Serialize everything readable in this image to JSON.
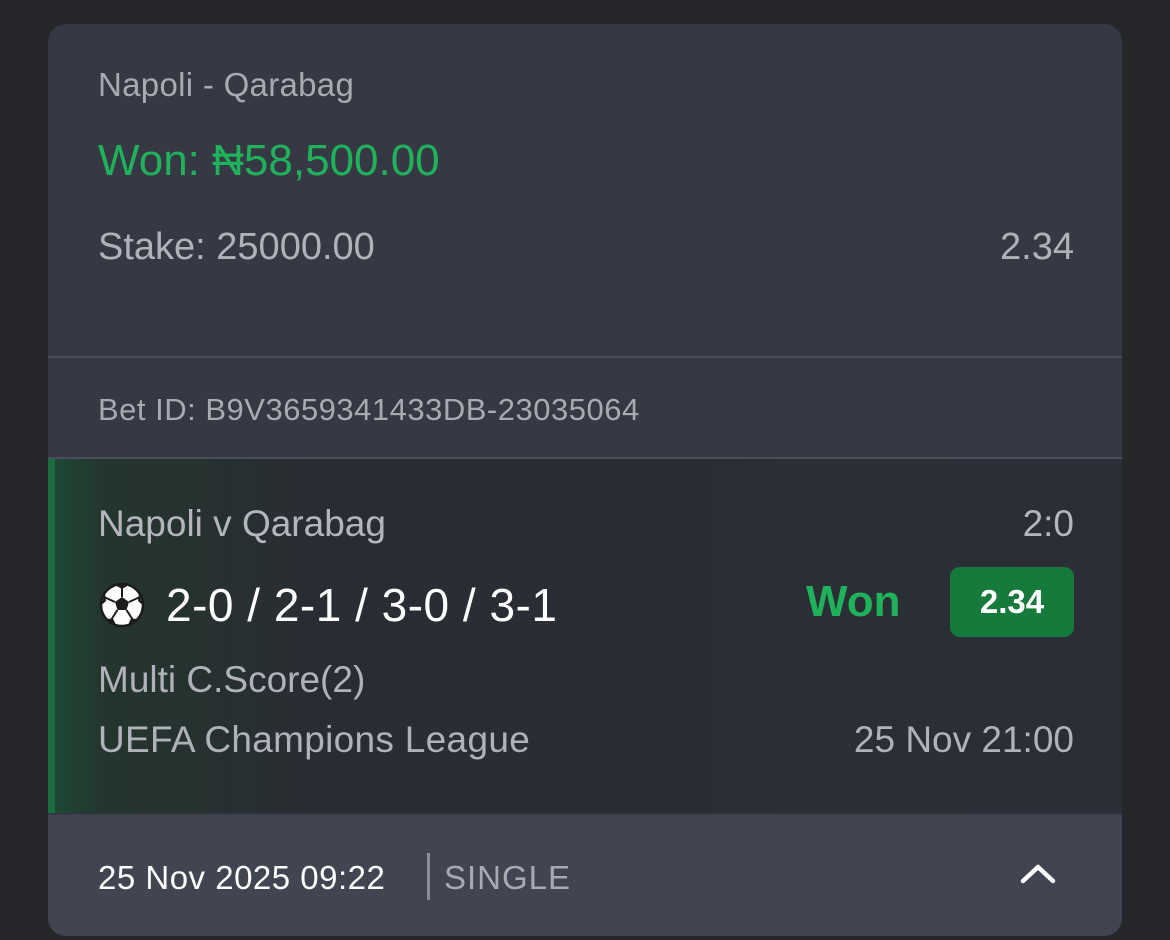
{
  "summary": {
    "match_title": "Napoli - Qarabag",
    "won_label": "Won: ₦58,500.00",
    "stake_label": "Stake: 25000.00",
    "total_odds": "2.34"
  },
  "bet_id": "Bet ID: B9V3659341433DB-23035064",
  "selection": {
    "event_name": "Napoli v Qarabag",
    "score": "2:0",
    "pick": "2-0 / 2-1 / 3-0 / 3-1",
    "status": "Won",
    "odds": "2.34",
    "market": "Multi C.Score(2)",
    "competition": "UEFA Champions League",
    "kickoff": "25 Nov 21:00",
    "sport_icon": "soccer-ball-icon"
  },
  "footer": {
    "placed_at": "25 Nov 2025 09:22",
    "bet_type": "SINGLE",
    "toggle_icon": "chevron-up-icon"
  },
  "colors": {
    "win_green": "#1fb25a",
    "badge_green": "#167a3d",
    "card_bg": "#363843",
    "footer_bg": "#414451"
  }
}
